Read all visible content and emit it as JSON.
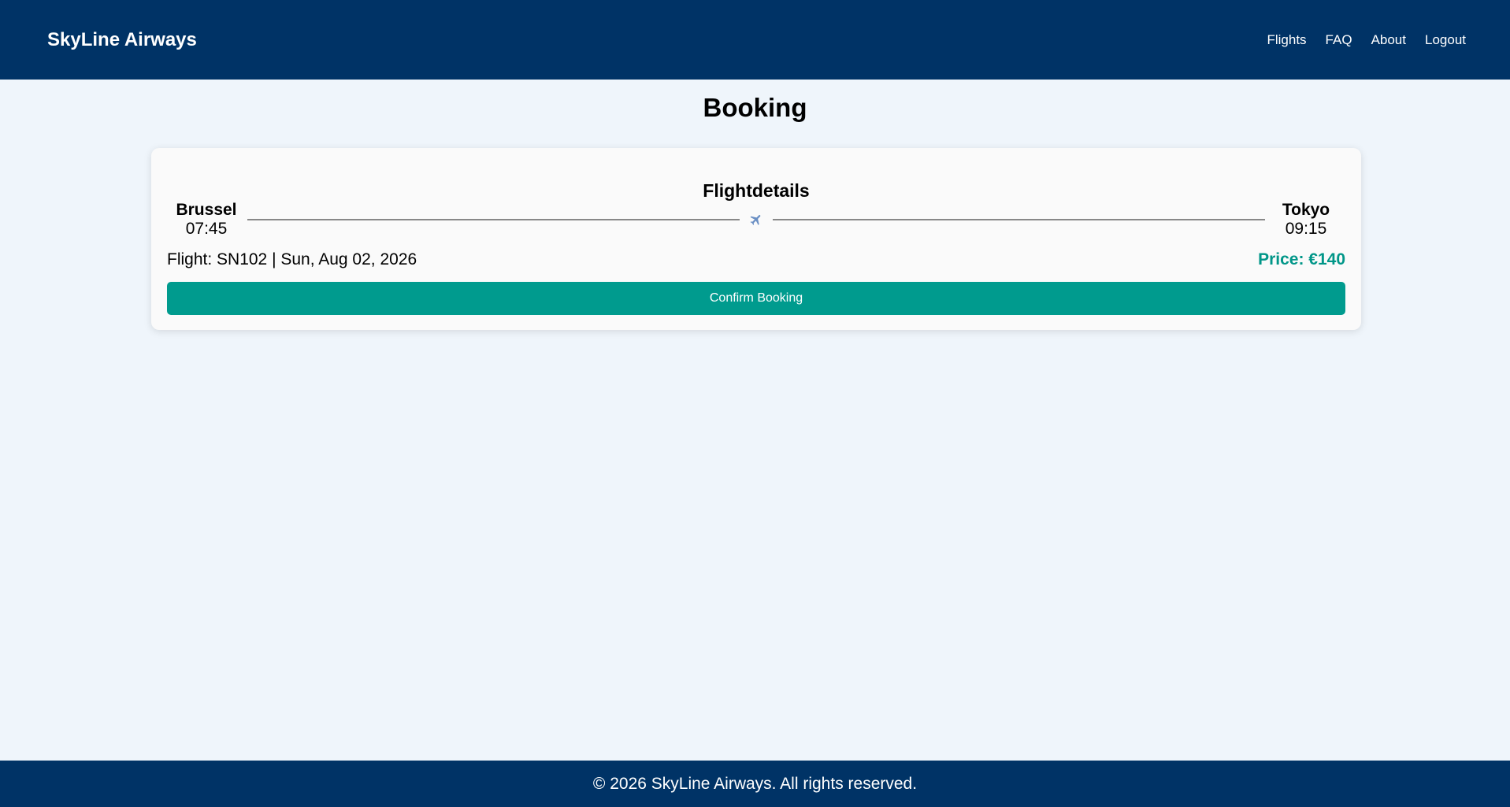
{
  "header": {
    "brand": "SkyLine Airways",
    "nav": [
      {
        "label": "Flights"
      },
      {
        "label": "FAQ"
      },
      {
        "label": "About"
      },
      {
        "label": "Logout"
      }
    ]
  },
  "page": {
    "title": "Booking"
  },
  "card": {
    "title": "Flightdetails",
    "origin": {
      "city": "Brussel",
      "time": "07:45"
    },
    "destination": {
      "city": "Tokyo",
      "time": "09:15"
    },
    "plane_icon": "airplane-icon",
    "flight_info": "Flight: SN102 | Sun, Aug 02, 2026",
    "price": "Price: €140",
    "confirm_label": "Confirm Booking"
  },
  "footer": {
    "text": "© 2026 SkyLine Airways. All rights reserved."
  },
  "colors": {
    "header_bg": "#003366",
    "accent": "#009b8e",
    "page_bg": "#eff5fb"
  }
}
